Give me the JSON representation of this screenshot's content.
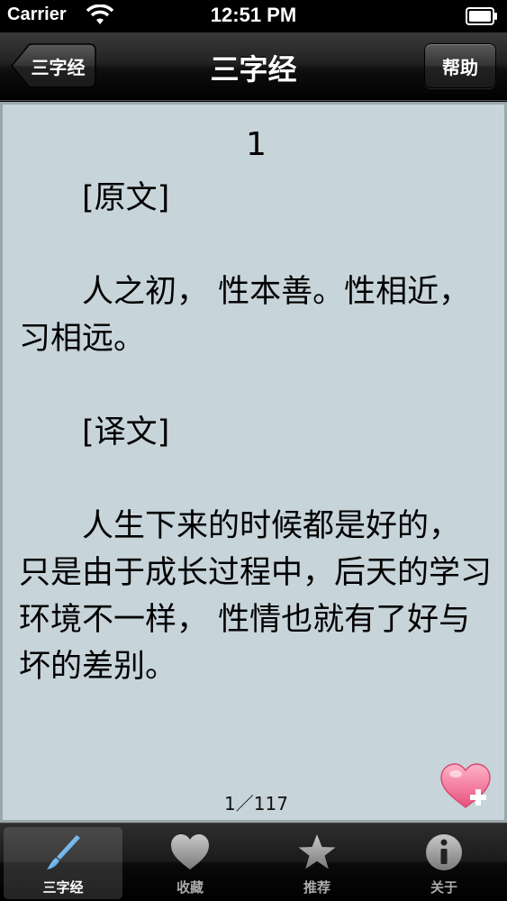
{
  "status_bar": {
    "carrier": "Carrier",
    "time": "12:51 PM",
    "icons": [
      "wifi-icon",
      "battery-icon"
    ]
  },
  "nav_bar": {
    "back_label": "三字经",
    "title": "三字经",
    "help_label": "帮助"
  },
  "content": {
    "verse_number": "1",
    "text": "　　[原文]\n\n　　人之初， 性本善。性相近， 习相远。\n\n　　[译文]\n\n　　人生下来的时候都是好的， 只是由于成长过程中，后天的学习环境不一样， 性情也就有了好与坏的差别。",
    "page_indicator": "1／117",
    "background_color": "#c7d4d9",
    "favorite_icon": "heart-plus-icon"
  },
  "tab_bar": {
    "tabs": [
      {
        "label": "三字经",
        "icon": "brush-icon",
        "selected": true
      },
      {
        "label": "收藏",
        "icon": "heart-icon",
        "selected": false
      },
      {
        "label": "推荐",
        "icon": "star-icon",
        "selected": false
      },
      {
        "label": "关于",
        "icon": "info-icon",
        "selected": false
      }
    ]
  }
}
